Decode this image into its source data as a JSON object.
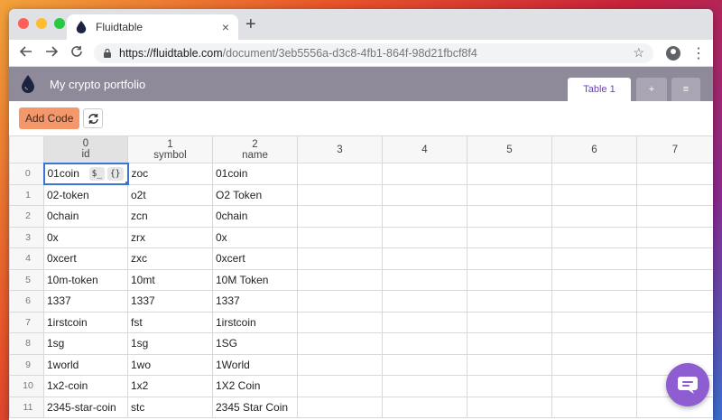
{
  "browser": {
    "tab_title": "Fluidtable",
    "tab_close": "×",
    "new_tab": "+",
    "url_host": "https://fluidtable.com",
    "url_path": "/document/3eb5556a-d3c8-4fb1-864f-98d21fbcf8f4",
    "star": "☆",
    "kebab": "⋮"
  },
  "app": {
    "doc_title": "My crypto portfolio",
    "tabs": [
      "Table 1",
      "+",
      "≡"
    ],
    "add_code_label": "Add Code"
  },
  "grid": {
    "columns": [
      {
        "index": "0",
        "name": "id"
      },
      {
        "index": "1",
        "name": "symbol"
      },
      {
        "index": "2",
        "name": "name"
      },
      {
        "index": "3",
        "name": ""
      },
      {
        "index": "4",
        "name": ""
      },
      {
        "index": "5",
        "name": ""
      },
      {
        "index": "6",
        "name": ""
      },
      {
        "index": "7",
        "name": ""
      }
    ],
    "cell_buttons": [
      "$_",
      "{}"
    ],
    "rows": [
      {
        "num": "0",
        "cells": [
          "01coin",
          "zoc",
          "01coin"
        ]
      },
      {
        "num": "1",
        "cells": [
          "02-token",
          "o2t",
          "O2 Token"
        ]
      },
      {
        "num": "2",
        "cells": [
          "0chain",
          "zcn",
          "0chain"
        ]
      },
      {
        "num": "3",
        "cells": [
          "0x",
          "zrx",
          "0x"
        ]
      },
      {
        "num": "4",
        "cells": [
          "0xcert",
          "zxc",
          "0xcert"
        ]
      },
      {
        "num": "5",
        "cells": [
          "10m-token",
          "10mt",
          "10M Token"
        ]
      },
      {
        "num": "6",
        "cells": [
          "1337",
          "1337",
          "1337"
        ]
      },
      {
        "num": "7",
        "cells": [
          "1irstcoin",
          "fst",
          "1irstcoin"
        ]
      },
      {
        "num": "8",
        "cells": [
          "1sg",
          "1sg",
          "1SG"
        ]
      },
      {
        "num": "9",
        "cells": [
          "1world",
          "1wo",
          "1World"
        ]
      },
      {
        "num": "10",
        "cells": [
          "1x2-coin",
          "1x2",
          "1X2 Coin"
        ]
      },
      {
        "num": "11",
        "cells": [
          "2345-star-coin",
          "stc",
          "2345 Star Coin"
        ]
      }
    ]
  },
  "colors": {
    "header_bar": "#8f8a99",
    "accent_purple": "#6b3fbf",
    "add_code_bg": "#f4976a",
    "selection_blue": "#3b73d6",
    "chat_bg": "#8e5dd1"
  },
  "icons": [
    "back-icon",
    "forward-icon",
    "reload-icon",
    "lock-icon",
    "star-icon",
    "account-icon",
    "menu-kebab-icon",
    "fluidtable-logo-icon",
    "refresh-icon",
    "chat-icon"
  ]
}
